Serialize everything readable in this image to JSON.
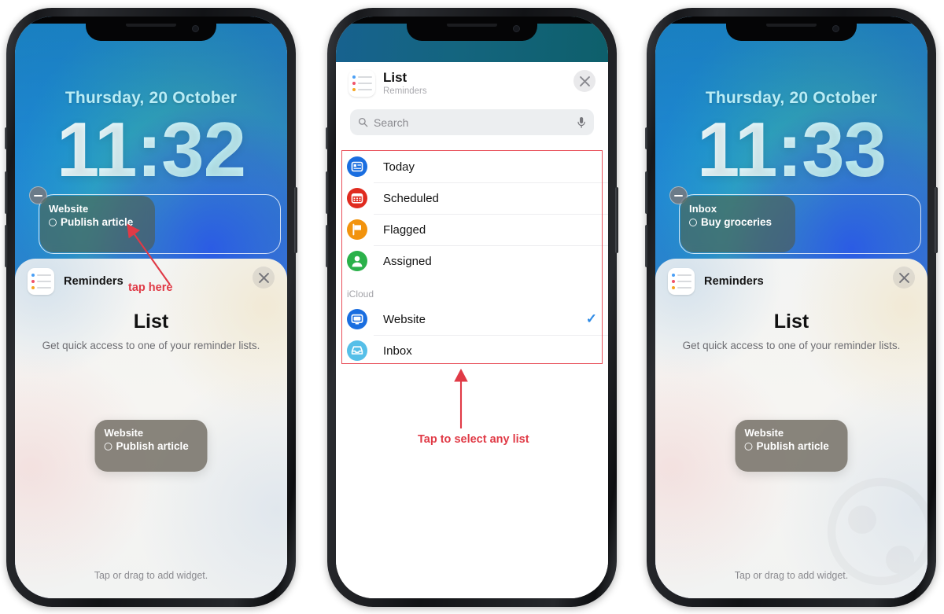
{
  "phones": [
    {
      "id": "phone-left",
      "lock": {
        "date": "Thursday, 20 October",
        "time": "11:32",
        "widget": {
          "list_name": "Website",
          "task": "Publish article"
        }
      },
      "sheet": {
        "app_name": "Reminders",
        "title": "List",
        "subtitle": "Get quick access to one of your reminder lists.",
        "preview": {
          "list_name": "Website",
          "task": "Publish article"
        },
        "footer": "Tap or drag to add widget.",
        "close_icon": "close-icon"
      }
    },
    {
      "id": "phone-right",
      "lock": {
        "date": "Thursday, 20 October",
        "time": "11:33",
        "widget": {
          "list_name": "Inbox",
          "task": "Buy groceries"
        }
      },
      "sheet": {
        "app_name": "Reminders",
        "title": "List",
        "subtitle": "Get quick access to one of your reminder lists.",
        "preview": {
          "list_name": "Website",
          "task": "Publish article"
        },
        "footer": "Tap or drag to add widget.",
        "close_icon": "close-icon"
      }
    }
  ],
  "picker": {
    "title": "List",
    "subtitle": "Reminders",
    "close_icon": "close-icon",
    "search": {
      "placeholder": "Search",
      "icon": "search-icon",
      "mic_icon": "microphone-icon"
    },
    "smart_lists": [
      {
        "label": "Today",
        "icon": "today-icon",
        "color": "#1a6ee0",
        "selected": false
      },
      {
        "label": "Scheduled",
        "icon": "calendar-icon",
        "color": "#e02b1f",
        "selected": false
      },
      {
        "label": "Flagged",
        "icon": "flag-icon",
        "color": "#f2930d",
        "selected": false
      },
      {
        "label": "Assigned",
        "icon": "person-icon",
        "color": "#2bb14a",
        "selected": false
      }
    ],
    "group_label": "iCloud",
    "account_lists": [
      {
        "label": "Website",
        "icon": "display-icon",
        "color": "#1a6ee0",
        "selected": true,
        "check": "✓"
      },
      {
        "label": "Inbox",
        "icon": "tray-icon",
        "color": "#56bfe8",
        "selected": false,
        "check": ""
      }
    ],
    "highlight_color": "#e8505a"
  },
  "annotations": {
    "tap_here": "tap here",
    "tap_select": "Tap to select any list",
    "color": "#e03a46"
  }
}
